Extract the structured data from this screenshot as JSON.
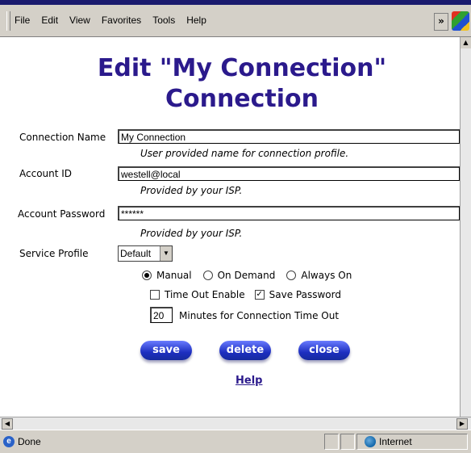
{
  "menu": [
    "File",
    "Edit",
    "View",
    "Favorites",
    "Tools",
    "Help"
  ],
  "toolbar": {
    "chevron": "»"
  },
  "page": {
    "title": "Edit \"My Connection\" Connection",
    "fields": {
      "connection_name": {
        "label": "Connection Name",
        "value": "My Connection",
        "hint": "User provided name for connection profile."
      },
      "account_id": {
        "label": "Account ID",
        "value": "westell@local",
        "hint": "Provided by your ISP."
      },
      "account_password": {
        "label": "Account Password",
        "value": "******",
        "hint": "Provided by your ISP."
      },
      "service_profile": {
        "label": "Service Profile",
        "value": "Default"
      }
    },
    "radios": [
      {
        "label": "Manual",
        "checked": true
      },
      {
        "label": "On Demand",
        "checked": false
      },
      {
        "label": "Always On",
        "checked": false
      }
    ],
    "checkboxes": [
      {
        "label": "Time Out Enable",
        "checked": false
      },
      {
        "label": "Save Password",
        "checked": true
      }
    ],
    "timeout": {
      "value": "20",
      "label": "Minutes for Connection Time Out"
    },
    "buttons": {
      "save": "save",
      "delete": "delete",
      "close": "close"
    },
    "help_link": "Help"
  },
  "status": {
    "left": "Done",
    "zone": "Internet"
  },
  "colors": {
    "title": "#2b1a8c",
    "button": "#1d2fc0"
  }
}
